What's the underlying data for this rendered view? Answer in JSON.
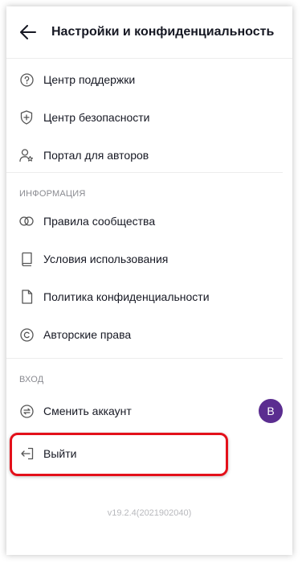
{
  "header": {
    "title": "Настройки и конфиденциальность"
  },
  "support": {
    "items": [
      {
        "label": "Центр поддержки",
        "icon": "help-circle-icon"
      },
      {
        "label": "Центр безопасности",
        "icon": "shield-plus-icon"
      },
      {
        "label": "Портал для авторов",
        "icon": "person-star-icon"
      }
    ]
  },
  "info": {
    "title": "ИНФОРМАЦИЯ",
    "items": [
      {
        "label": "Правила сообщества",
        "icon": "rings-icon"
      },
      {
        "label": "Условия использования",
        "icon": "book-icon"
      },
      {
        "label": "Политика конфиденциальности",
        "icon": "document-icon"
      },
      {
        "label": "Авторские права",
        "icon": "copyright-icon"
      }
    ]
  },
  "login": {
    "title": "ВХОД",
    "switch_account": "Сменить аккаунт",
    "avatar_letter": "B",
    "logout": "Выйти"
  },
  "version": "v19.2.4(2021902040)",
  "colors": {
    "highlight": "#e3101a",
    "avatar": "#5b2d90"
  }
}
